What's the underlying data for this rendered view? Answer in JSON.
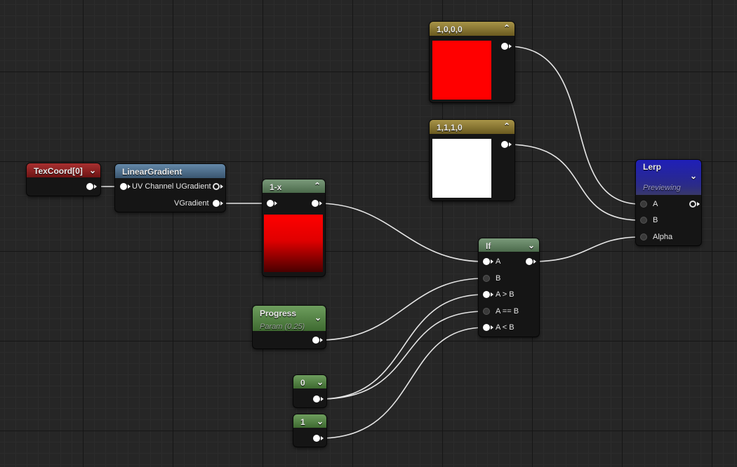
{
  "nodes": {
    "texcoord": {
      "title": "TexCoord[0]"
    },
    "lineargradient": {
      "title": "LinearGradient",
      "pin_ugradient": "UV Channel UGradient",
      "pin_vgradient": "VGradient"
    },
    "one_minus_x": {
      "title": "1-x"
    },
    "const_red": {
      "title": "1,0,0,0",
      "color": "#ff0000"
    },
    "const_white": {
      "title": "1,1,1,0",
      "color": "#ffffff"
    },
    "progress": {
      "title": "Progress",
      "subtitle": "Param (0.25)"
    },
    "const_0": {
      "title": "0"
    },
    "const_1": {
      "title": "1"
    },
    "if_node": {
      "title": "If",
      "pins": [
        "A",
        "B",
        "A > B",
        "A == B",
        "A < B"
      ]
    },
    "lerp": {
      "title": "Lerp",
      "subtitle": "Previewing",
      "pins": [
        "A",
        "B",
        "Alpha"
      ]
    }
  },
  "colors": {
    "header_red": "#8a1c1c",
    "header_blue": "#4a6d8c",
    "header_green": "#5e8d4e",
    "header_gold": "#8a7a34",
    "header_lerp": "#2323a8",
    "canvas": "#262626",
    "wire": "#e6e6e6"
  }
}
